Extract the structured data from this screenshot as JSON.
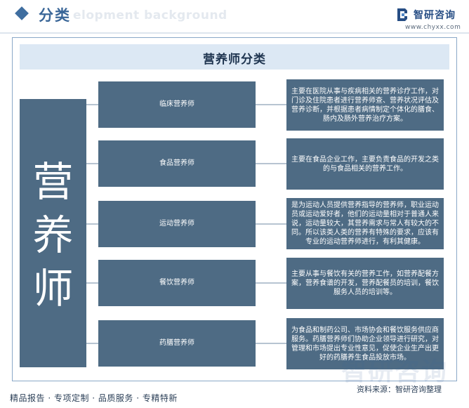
{
  "header": {
    "section_title": "分类",
    "background_word": "elopment background",
    "brand_name": "智研咨询",
    "brand_url": "www.chyxx.com"
  },
  "diagram": {
    "title": "营养师分类",
    "root_label": "营养师",
    "branches": [
      {
        "label": "临床营养师",
        "description": "主要在医院从事与疾病相关的营养诊疗工作，对门诊及住院患者进行营养师查、营养状况评估及营养诊断，并根据患者病情制定个体化的膳食、肠内及肠外营养治疗方案。"
      },
      {
        "label": "食品营养师",
        "description": "主要在食品企业工作，主要负责食品的开发之类的与食品相关的营养工作。"
      },
      {
        "label": "运动营养师",
        "description": "是为运动人员提供营养指导的营养师，职业运动员或运动爱好者，他们的运动量相对于普通人来说，运动量较大，其营养需求与常人有较大的不同。所以该类人类的营养有特殊的要求，应该有专业的运动营养师进行，有利其健康。"
      },
      {
        "label": "餐饮营养师",
        "description": "主要从事与餐饮有关的营养工作，如营养配餐方案，营养食谱的开发，营养配餐员的培训，餐饮服务人员的培训等。"
      },
      {
        "label": "药膳营养师",
        "description": "为食品和制药公司、市场协会和餐饮服务供应商服务。药膳营养师们协助企业领导进行研究，对管理和市场提出专业性意见，促使企业生产出更好的药膳养生食品投放市场。"
      }
    ]
  },
  "footer": {
    "services": "精品报告 · 专项定制 · 品质服务 · 专精特新",
    "source": "资料来源：智研咨询整理",
    "watermark": "智研咨询"
  },
  "colors": {
    "box_fill": "#4e6b84",
    "title_bar": "#dce8f4",
    "accent": "#3a6698",
    "connector": "#6f8aa3"
  },
  "icons": [
    "diamond-bullet-icon",
    "chyxx-logo-icon"
  ]
}
